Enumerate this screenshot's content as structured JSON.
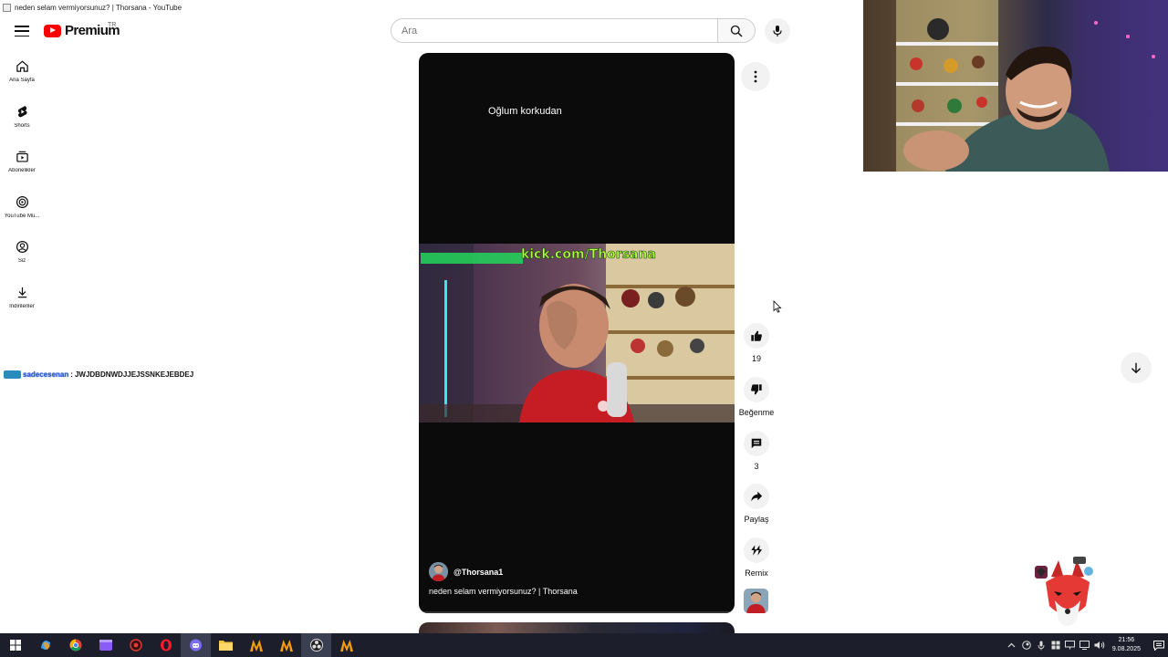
{
  "window": {
    "title": "neden selam vermiyorsunuz? | Thorsana - YouTube"
  },
  "masthead": {
    "logo_text": "Premium",
    "region": "TR",
    "search_placeholder": "Ara",
    "search_value": ""
  },
  "sidebar": {
    "items": [
      {
        "label": "Ana Sayfa",
        "icon": "home-icon"
      },
      {
        "label": "Shorts",
        "icon": "shorts-icon"
      },
      {
        "label": "Abonelikler",
        "icon": "subscriptions-icon"
      },
      {
        "label": "YouTube Mu...",
        "icon": "youtube-music-icon"
      },
      {
        "label": "Siz",
        "icon": "you-icon"
      },
      {
        "label": "İndirilenler",
        "icon": "downloads-icon"
      }
    ]
  },
  "chat": {
    "username": "sadecesenan",
    "separator": ":",
    "message": "JWJDBDNWDJJEJSSNKEJEBDEJ"
  },
  "short": {
    "overlay_text": "Oğlum korkudan",
    "channel_handle": "@Thorsana1",
    "caption": "neden selam vermiyorsunuz? | Thorsana",
    "progress": 0.01
  },
  "actions": {
    "like_count": "19",
    "dislike_label": "Beğenme",
    "comment_count": "3",
    "share_label": "Paylaş",
    "remix_label": "Remix"
  },
  "clock": {
    "time": "21:56",
    "date": "9.08.2025"
  },
  "colors": {
    "brand_red": "#ff0000",
    "taskbar": "#1c1f2b"
  }
}
